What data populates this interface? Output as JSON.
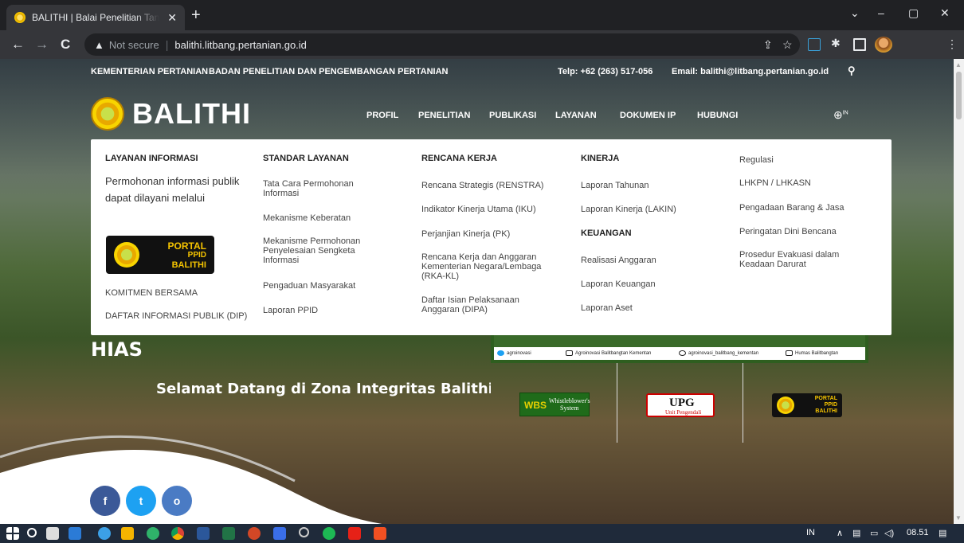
{
  "browser": {
    "tab_title": "BALITHI | Balai Penelitian Tanaman Hias",
    "tab_close": "✕",
    "new_tab": "+",
    "security_label": "Not secure",
    "url": "balithi.litbang.pertanian.go.id",
    "window_controls": [
      "⌄",
      "–",
      "▢",
      "✕"
    ]
  },
  "topbar": {
    "ministry": "KEMENTERIAN PERTANIAN",
    "agency": "BADAN PENELITIAN DAN PENGEMBANGAN PERTANIAN",
    "phone": "Telp: +62 (263) 517-056",
    "email": "Email: balithi@litbang.pertanian.go.id"
  },
  "site": {
    "logo_text": "BALITHI",
    "nav": [
      "PROFIL",
      "PENELITIAN",
      "PUBLIKASI",
      "LAYANAN",
      "DOKUMEN IP",
      "HUBUNGI"
    ],
    "lang_sup": "IN"
  },
  "mega_menu": {
    "col1": {
      "heading": "LAYANAN INFORMASI",
      "intro": "Permohonan informasi publik dapat dilayani melalui",
      "portal": [
        "PORTAL",
        "PPID",
        "BALITHI"
      ],
      "items": [
        "KOMITMEN BERSAMA",
        "DAFTAR INFORMASI PUBLIK (DIP)"
      ]
    },
    "col2": {
      "heading": "STANDAR LAYANAN",
      "items": [
        "Tata Cara Permohonan Informasi",
        "Mekanisme Keberatan",
        "Mekanisme Permohonan Penyelesaian Sengketa Informasi",
        "Pengaduan Masyarakat",
        "Laporan PPID"
      ]
    },
    "col3": {
      "heading": "RENCANA KERJA",
      "items": [
        "Rencana Strategis (RENSTRA)",
        "Indikator Kinerja Utama (IKU)",
        "Perjanjian Kinerja (PK)",
        "Rencana Kerja dan Anggaran Kementerian Negara/Lembaga (RKA-KL)",
        "Daftar Isian Pelaksanaan Anggaran (DIPA)"
      ]
    },
    "col4": {
      "heading": "KINERJA",
      "items": [
        "Laporan Tahunan",
        "Laporan Kinerja (LAKIN)"
      ],
      "heading2": "KEUANGAN",
      "items2": [
        "Realisasi Anggaran",
        "Laporan Keuangan",
        "Laporan Aset"
      ]
    },
    "col5": {
      "items": [
        "Regulasi",
        "LHKPN / LHKASN",
        "Pengadaan Barang & Jasa",
        "Peringatan Dini Bencana",
        "Prosedur Evakuasi dalam Keadaan Darurat"
      ]
    }
  },
  "hero": {
    "title_fragment": "HIAS",
    "welcome": "Selamat Datang di Zona Integritas Balithi Lembang"
  },
  "social_strip": [
    "agroinovasi",
    "Agroinovasi Balitbangtan Kementan",
    "agroinovasi_balitbang_kementan",
    "Humas Balitbangtan"
  ],
  "banners": {
    "wbs_short": "WBS",
    "wbs_long": "Whistleblower's System",
    "upg": "UPG",
    "upg_sub": "Unit Pengendali"
  },
  "social_buttons": [
    "f",
    "t",
    "o"
  ],
  "taskbar": {
    "lang": "IN",
    "time": "08.51"
  },
  "colors": {
    "facebook": "#3b5998",
    "twitter": "#1da1f2",
    "instagram": "#4a7bc4",
    "accent_yellow": "#f5c400"
  }
}
